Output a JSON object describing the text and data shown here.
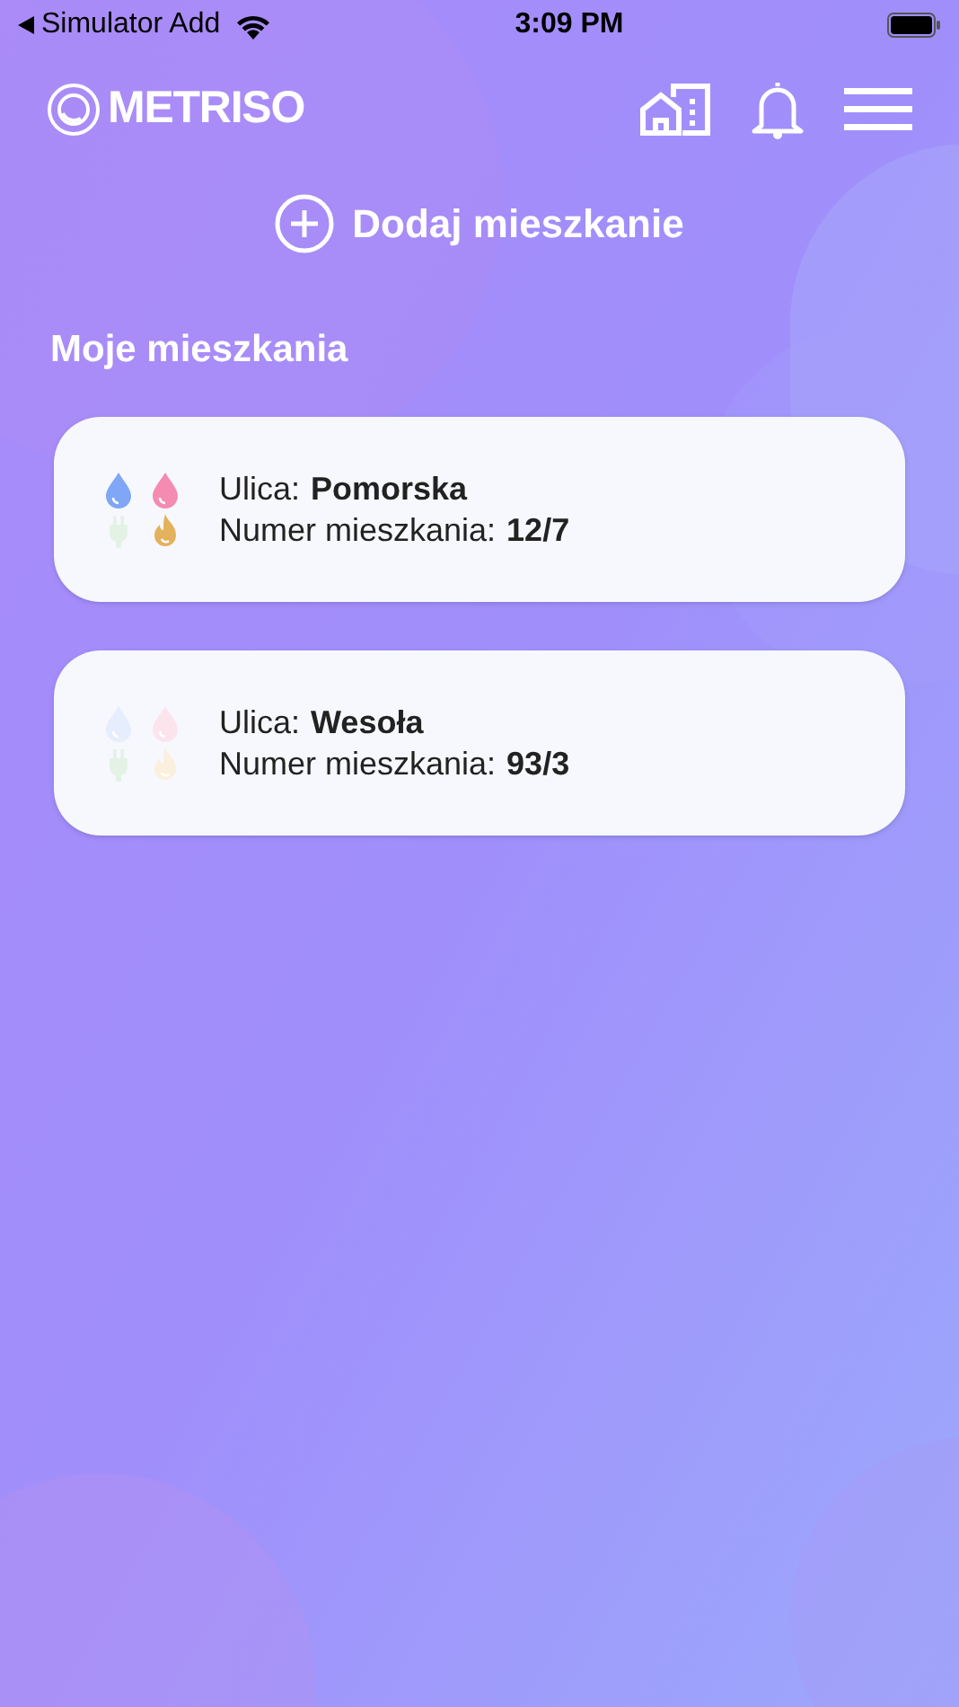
{
  "status_bar": {
    "back_label": "Simulator Add",
    "time": "3:09 PM"
  },
  "header": {
    "logo_text": "METRISO"
  },
  "add_button": {
    "label": "Dodaj mieszkanie"
  },
  "section_title": "Moje mieszkania",
  "apartments": [
    {
      "street_label": "Ulica:",
      "street": "Pomorska",
      "number_label": "Numer mieszkania:",
      "number": "12/7",
      "utilities": [
        {
          "kind": "cold_water",
          "active": true
        },
        {
          "kind": "hot_water",
          "active": true
        },
        {
          "kind": "electricity",
          "active": false
        },
        {
          "kind": "gas",
          "active": true
        }
      ]
    },
    {
      "street_label": "Ulica:",
      "street": "Wesoła",
      "number_label": "Numer mieszkania:",
      "number": "93/3",
      "utilities": [
        {
          "kind": "cold_water",
          "active": false
        },
        {
          "kind": "hot_water",
          "active": false
        },
        {
          "kind": "electricity",
          "active": false
        },
        {
          "kind": "gas",
          "active": false
        }
      ]
    }
  ]
}
